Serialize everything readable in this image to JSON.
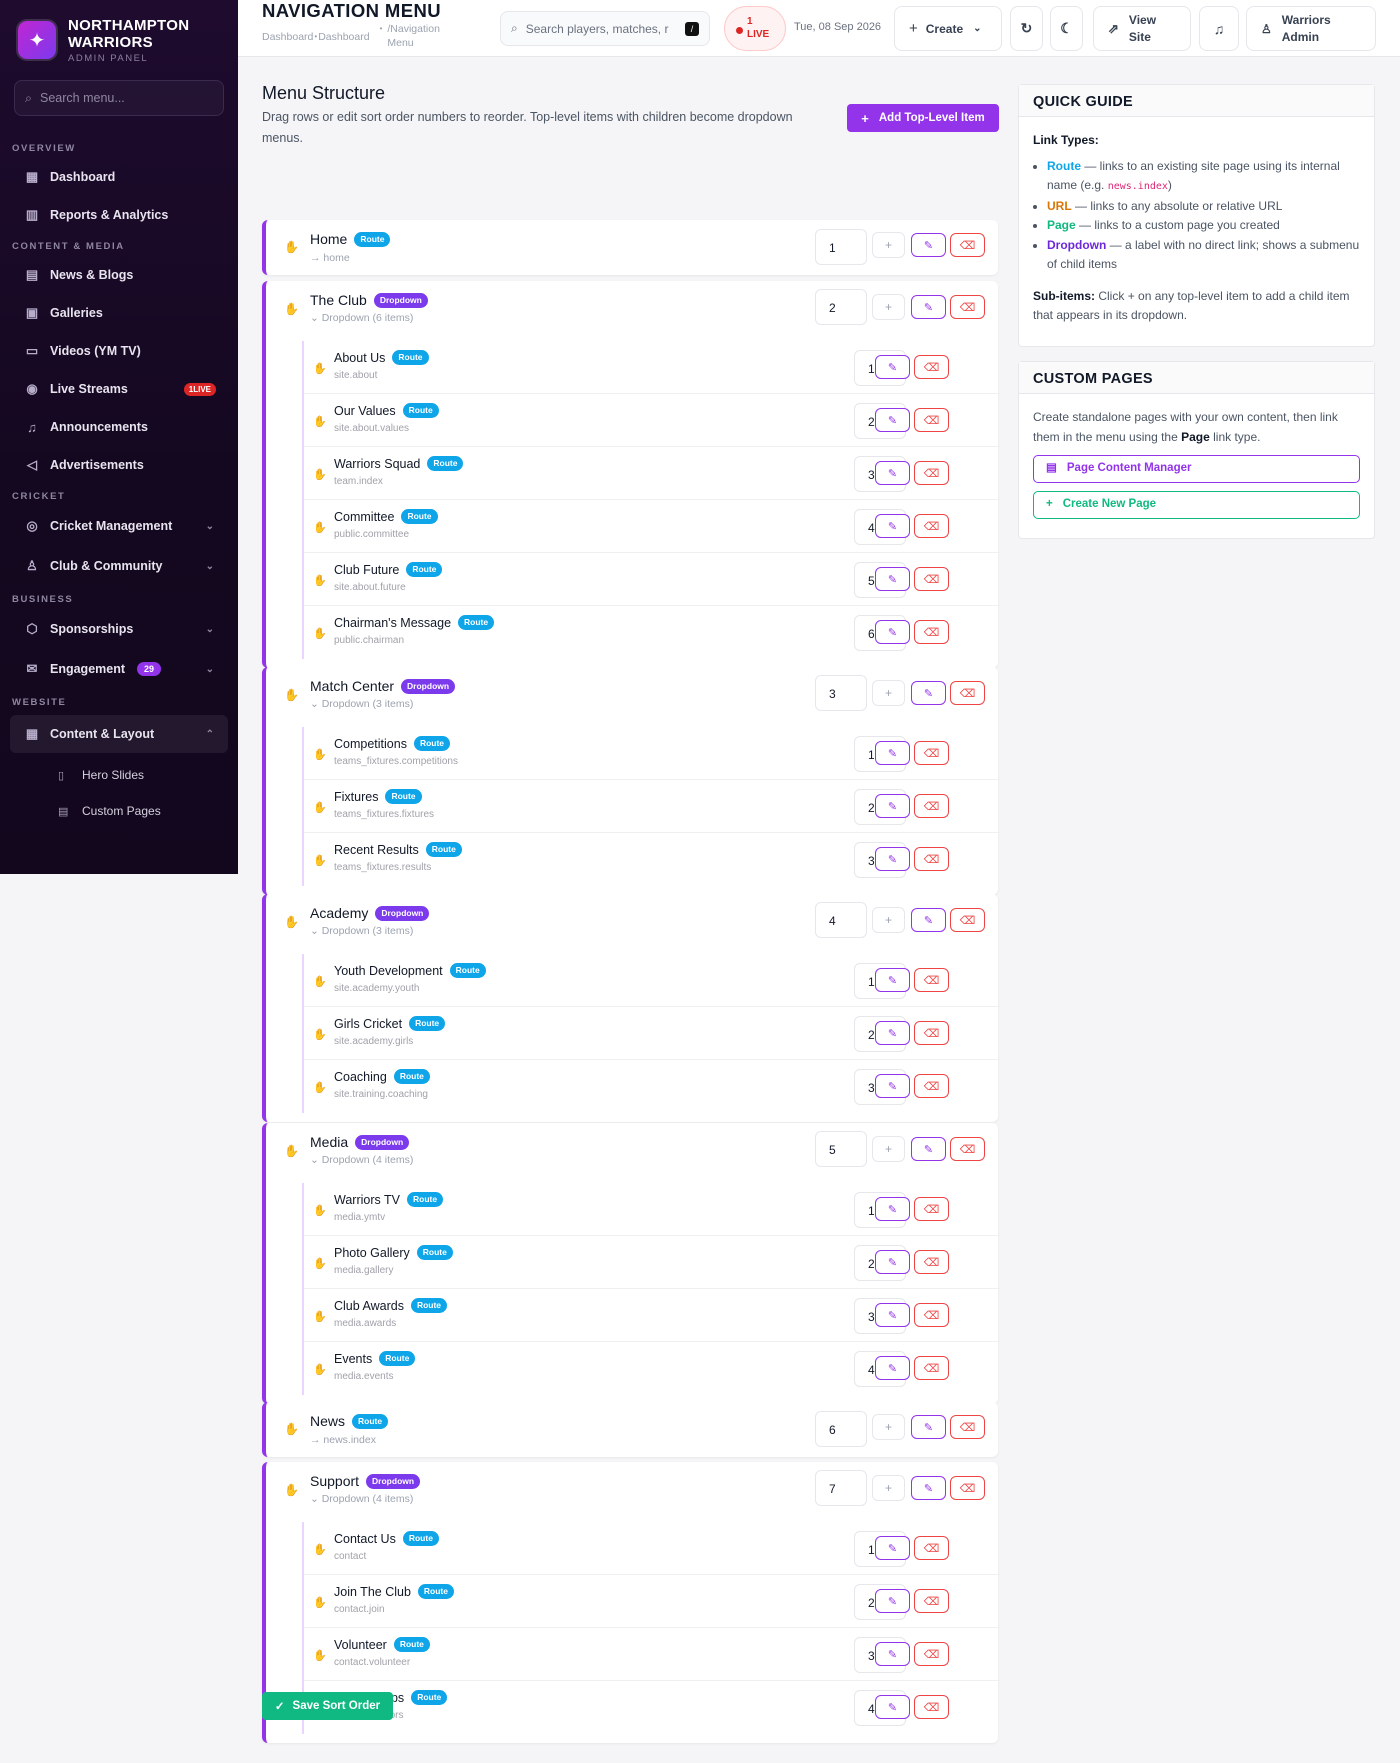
{
  "brand": {
    "name_line1": "NORTHAMPTON",
    "name_line2": "WARRIORS",
    "subtitle": "ADMIN PANEL"
  },
  "sidebar": {
    "search_placeholder": "Search menu...",
    "sections": {
      "overview": "OVERVIEW",
      "content": "CONTENT & MEDIA",
      "cricket": "CRICKET",
      "business": "BUSINESS",
      "website": "WEBSITE"
    },
    "items": {
      "dashboard": "Dashboard",
      "reports": "Reports & Analytics",
      "news": "News & Blogs",
      "galleries": "Galleries",
      "videos": "Videos (YM TV)",
      "streams": "Live Streams",
      "streams_badge": "1LIVE",
      "announcements": "Announcements",
      "ads": "Advertisements",
      "cricket_mgmt": "Cricket Management",
      "club": "Club & Community",
      "sponsorships": "Sponsorships",
      "engagement": "Engagement",
      "engagement_badge": "29",
      "content_layout": "Content & Layout",
      "hero": "Hero Slides",
      "custom_pages": "Custom Pages"
    }
  },
  "topbar": {
    "title": "NAVIGATION MENU",
    "crumb1": "Dashboard",
    "crumb2": "Dashboard",
    "crumb3": "/Navigation Menu",
    "search_placeholder": "Search players, matches, r",
    "kbd": "/",
    "live_count": "1",
    "live_label": "LIVE",
    "date": "Tue, 08 Sep 2026",
    "create": "Create",
    "view_site": "View Site",
    "user": "Warriors Admin"
  },
  "menu": {
    "title": "Menu Structure",
    "description": "Drag rows or edit sort order numbers to reorder. Top-level items with children become dropdown menus.",
    "add_button": "Add Top-Level Item",
    "save_button": "Save Sort Order",
    "items": [
      {
        "label": "Home",
        "type": "Route",
        "sub": "home",
        "order": "1",
        "children": []
      },
      {
        "label": "The Club",
        "type": "Dropdown",
        "sub": "Dropdown (6 items)",
        "order": "2",
        "children": [
          {
            "label": "About Us",
            "type": "Route",
            "sub": "site.about",
            "order": "1"
          },
          {
            "label": "Our Values",
            "type": "Route",
            "sub": "site.about.values",
            "order": "2"
          },
          {
            "label": "Warriors Squad",
            "type": "Route",
            "sub": "team.index",
            "order": "3"
          },
          {
            "label": "Committee",
            "type": "Route",
            "sub": "public.committee",
            "order": "4"
          },
          {
            "label": "Club Future",
            "type": "Route",
            "sub": "site.about.future",
            "order": "5"
          },
          {
            "label": "Chairman's Message",
            "type": "Route",
            "sub": "public.chairman",
            "order": "6"
          }
        ]
      },
      {
        "label": "Match Center",
        "type": "Dropdown",
        "sub": "Dropdown (3 items)",
        "order": "3",
        "children": [
          {
            "label": "Competitions",
            "type": "Route",
            "sub": "teams_fixtures.competitions",
            "order": "1"
          },
          {
            "label": "Fixtures",
            "type": "Route",
            "sub": "teams_fixtures.fixtures",
            "order": "2"
          },
          {
            "label": "Recent Results",
            "type": "Route",
            "sub": "teams_fixtures.results",
            "order": "3"
          }
        ]
      },
      {
        "label": "Academy",
        "type": "Dropdown",
        "sub": "Dropdown (3 items)",
        "order": "4",
        "children": [
          {
            "label": "Youth Development",
            "type": "Route",
            "sub": "site.academy.youth",
            "order": "1"
          },
          {
            "label": "Girls Cricket",
            "type": "Route",
            "sub": "site.academy.girls",
            "order": "2"
          },
          {
            "label": "Coaching",
            "type": "Route",
            "sub": "site.training.coaching",
            "order": "3"
          }
        ]
      },
      {
        "label": "Media",
        "type": "Dropdown",
        "sub": "Dropdown (4 items)",
        "order": "5",
        "children": [
          {
            "label": "Warriors TV",
            "type": "Route",
            "sub": "media.ymtv",
            "order": "1"
          },
          {
            "label": "Photo Gallery",
            "type": "Route",
            "sub": "media.gallery",
            "order": "2"
          },
          {
            "label": "Club Awards",
            "type": "Route",
            "sub": "media.awards",
            "order": "3"
          },
          {
            "label": "Events",
            "type": "Route",
            "sub": "media.events",
            "order": "4"
          }
        ]
      },
      {
        "label": "News",
        "type": "Route",
        "sub": "news.index",
        "order": "6",
        "children": []
      },
      {
        "label": "Support",
        "type": "Dropdown",
        "sub": "Dropdown (4 items)",
        "order": "7",
        "children": [
          {
            "label": "Contact Us",
            "type": "Route",
            "sub": "contact",
            "order": "1"
          },
          {
            "label": "Join The Club",
            "type": "Route",
            "sub": "contact.join",
            "order": "2"
          },
          {
            "label": "Volunteer",
            "type": "Route",
            "sub": "contact.volunteer",
            "order": "3"
          },
          {
            "label": "Partnerships",
            "type": "Route",
            "sub": "public.sponsors",
            "order": "4"
          }
        ]
      }
    ]
  },
  "guide": {
    "title": "QUICK GUIDE",
    "link_types_label": "Link Types:",
    "route_name": "Route",
    "route_desc": " — links to an existing site page using its internal name (e.g. ",
    "route_example": "news.index",
    "route_close": ")",
    "url_name": "URL",
    "url_desc": " — links to any absolute or relative URL",
    "page_name": "Page",
    "page_desc": " — links to a custom page you created",
    "dropdown_name": "Dropdown",
    "dropdown_desc": " — a label with no direct link; shows a submenu of child items",
    "subitems_label": "Sub-items:",
    "subitems_desc1": " Click ",
    "subitems_plus": "+",
    "subitems_desc2": " on any top-level item to add a child item that appears in its dropdown."
  },
  "custom_pages": {
    "title": "CUSTOM PAGES",
    "desc1": "Create standalone pages with your own content, then link them in the menu using the ",
    "desc_bold": "Page",
    "desc2": " link type.",
    "manager_button": "Page Content Manager",
    "create_button": "Create New Page"
  },
  "colors": {
    "accent": "#9333ea",
    "route": "#0ea5e9",
    "dropdown": "#7c3aed",
    "url": "#d97706",
    "page": "#10b981",
    "danger": "#ef4444"
  }
}
